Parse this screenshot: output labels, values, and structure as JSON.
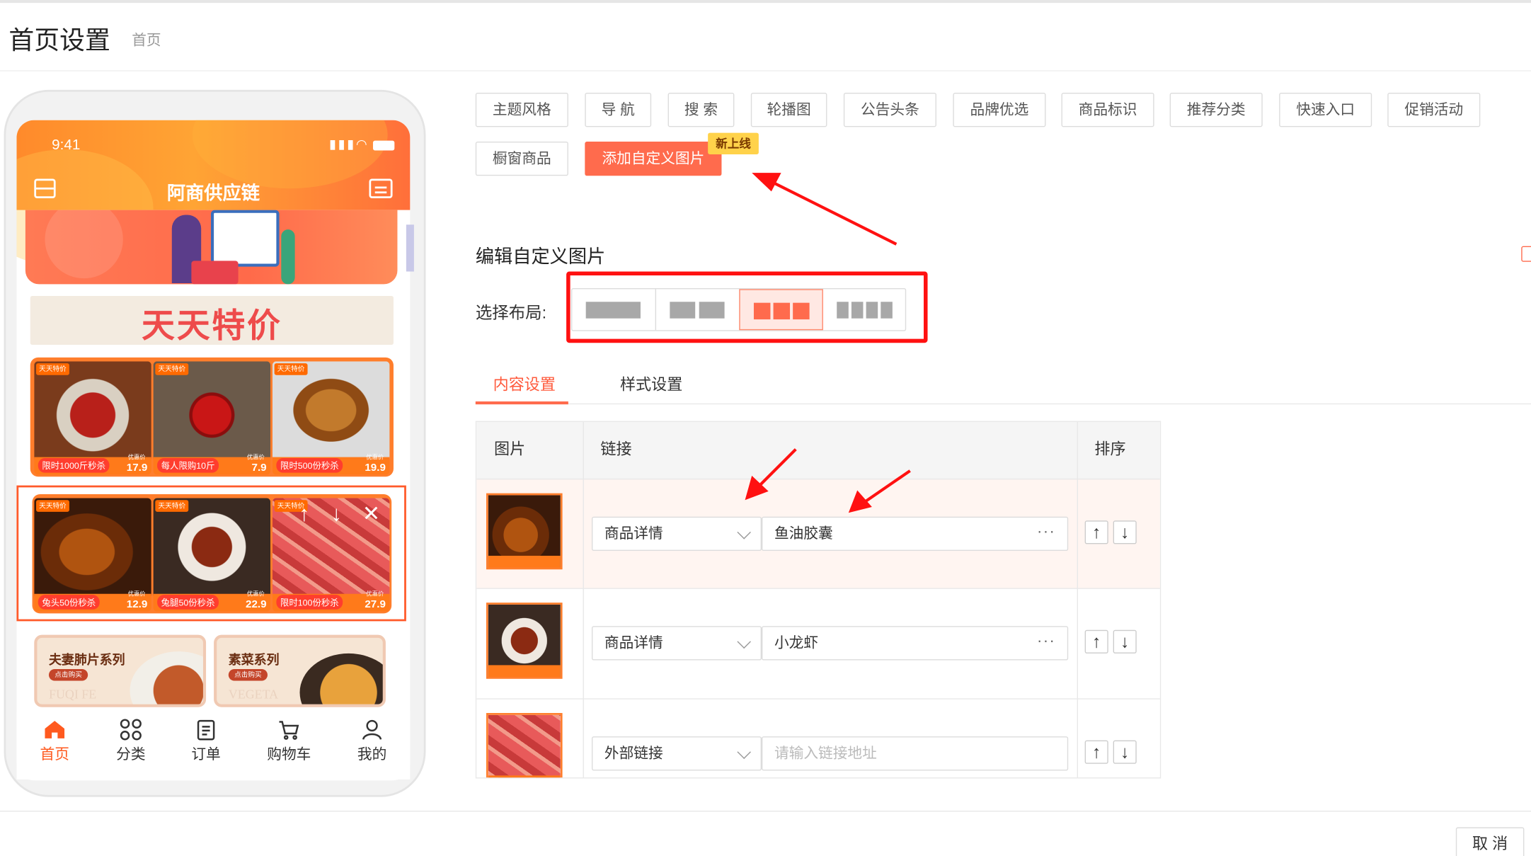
{
  "header": {
    "title": "首页设置",
    "breadcrumb": "首页"
  },
  "phone": {
    "time": "9:41",
    "app_title": "阿商供应链",
    "special_banner": "天天特价",
    "row1": [
      {
        "tag": "天天特价",
        "label": "限时1000斤秒杀",
        "price_pre": "优惠价",
        "price": "17.9",
        "icon": "spaghetti"
      },
      {
        "tag": "天天特价",
        "label": "每人限购10斤",
        "price_pre": "优惠价",
        "price": "7.9",
        "icon": "apple"
      },
      {
        "tag": "天天特价",
        "label": "限时500份秒杀",
        "price_pre": "优惠价",
        "price": "19.9",
        "icon": "roast-chicken"
      }
    ],
    "row2": [
      {
        "tag": "天天特价",
        "label": "兔头50份秒杀",
        "price_pre": "优惠价",
        "price": "12.9",
        "icon": "roast-goose"
      },
      {
        "tag": "天天特价",
        "label": "兔腿50份秒杀",
        "price_pre": "优惠价",
        "price": "22.9",
        "icon": "chicken-wings"
      },
      {
        "tag": "天天特价",
        "label": "限时100份秒杀",
        "price_pre": "优惠价",
        "price": "27.9",
        "icon": "sliced-beef"
      }
    ],
    "controls": {
      "up": "↑",
      "down": "↓",
      "close": "✕"
    },
    "series": [
      {
        "title": "夫妻肺片系列",
        "button": "点击购买",
        "en": "FUQI FE"
      },
      {
        "title": "素菜系列",
        "button": "点击购买",
        "en": "VEGETA"
      }
    ],
    "tabbar": [
      {
        "label": "首页",
        "icon": "home-icon",
        "active": true
      },
      {
        "label": "分类",
        "icon": "category-icon",
        "active": false
      },
      {
        "label": "订单",
        "icon": "order-icon",
        "active": false
      },
      {
        "label": "购物车",
        "icon": "cart-icon",
        "active": false
      },
      {
        "label": "我的",
        "icon": "user-icon",
        "active": false
      }
    ]
  },
  "modules": {
    "row1": [
      "主题风格",
      "导 航",
      "搜 索",
      "轮播图",
      "公告头条",
      "品牌优选",
      "商品标识",
      "推荐分类",
      "快速入口",
      "促销活动"
    ],
    "row2": [
      "橱窗商品",
      "添加自定义图片"
    ],
    "new_badge": "新上线"
  },
  "editor": {
    "title": "编辑自定义图片",
    "layout_label": "选择布局:",
    "layout_options": [
      1,
      2,
      3,
      4
    ],
    "layout_selected": 3,
    "tabs": [
      "内容设置",
      "样式设置"
    ],
    "active_tab": 0,
    "table": {
      "headers": [
        "图片",
        "链接",
        "排序"
      ],
      "rows": [
        {
          "link_type": "商品详情",
          "link_value": "鱼油胶囊",
          "placeholder": "",
          "thumb": "roast-goose",
          "highlight": true
        },
        {
          "link_type": "商品详情",
          "link_value": "小龙虾",
          "placeholder": "",
          "thumb": "chicken-wings",
          "highlight": false
        },
        {
          "link_type": "外部链接",
          "link_value": "",
          "placeholder": "请输入链接地址",
          "thumb": "sliced-beef",
          "highlight": false
        }
      ],
      "dots": "···",
      "sort_up": "↑",
      "sort_down": "↓"
    }
  },
  "footer": {
    "cancel": "取 消"
  },
  "colors": {
    "accent": "#ff6b4d",
    "annotation": "#ff1111",
    "selection": "#ff5a2a"
  }
}
